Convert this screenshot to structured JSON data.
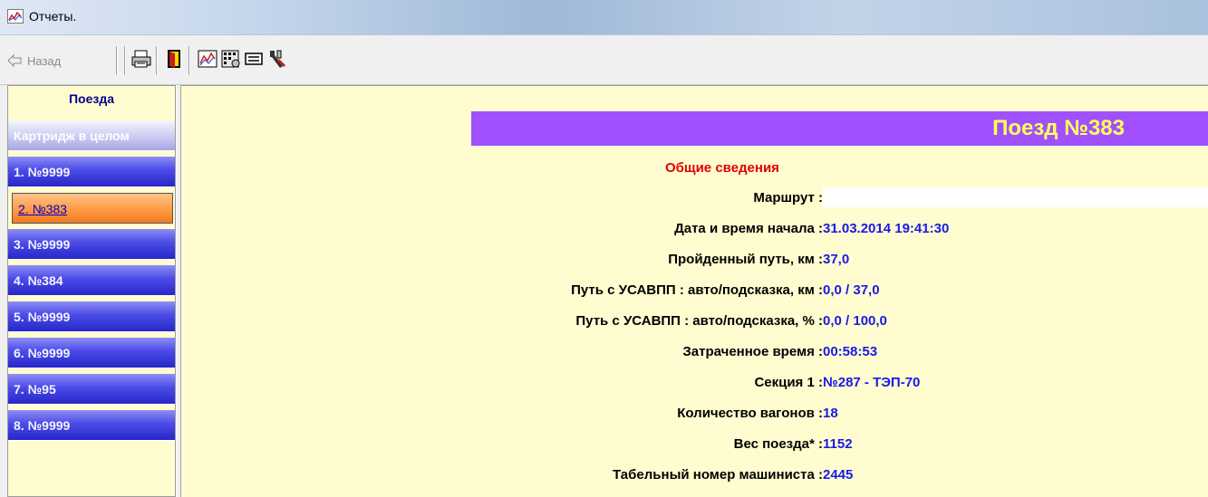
{
  "window": {
    "title": "Отчеты.",
    "icon": "chart-icon"
  },
  "toolbar": {
    "back_label": "Назад",
    "buttons": [
      "print-icon",
      "exit-door-icon",
      "chart-icon",
      "settings-chart-icon",
      "display-icon",
      "tools-icon"
    ]
  },
  "sidebar": {
    "header": "Поезда",
    "items": [
      {
        "label": "Картридж в целом",
        "state": "gray"
      },
      {
        "label": "1. №9999",
        "state": "normal"
      },
      {
        "label": "2. №383",
        "state": "active"
      },
      {
        "label": "3. №9999",
        "state": "normal"
      },
      {
        "label": "4. №384",
        "state": "normal"
      },
      {
        "label": "5. №9999",
        "state": "normal"
      },
      {
        "label": "6. №9999",
        "state": "normal"
      },
      {
        "label": "7. №95",
        "state": "normal"
      },
      {
        "label": "8. №9999",
        "state": "normal"
      }
    ]
  },
  "report": {
    "title": "Поезд №383",
    "section_title": "Общие сведения",
    "rows": [
      {
        "label": "Маршрут :",
        "value": ""
      },
      {
        "label": "Дата и время начала :",
        "value": "31.03.2014 19:41:30"
      },
      {
        "label": "Пройденный путь, км :",
        "value": "37,0"
      },
      {
        "label": "Путь с УСАВПП : авто/подсказка, км :",
        "value": "0,0 / 37,0"
      },
      {
        "label": "Путь с УСАВПП : авто/подсказка, % :",
        "value": "0,0 / 100,0"
      },
      {
        "label": "Затраченное время :",
        "value": "00:58:53"
      },
      {
        "label": "Секция 1 :",
        "value": "№287 - ТЭП-70"
      },
      {
        "label": "Количество вагонов :",
        "value": "18"
      },
      {
        "label": "Вес поезда* :",
        "value": "1152"
      },
      {
        "label": "Табельный номер машиниста :",
        "value": "2445"
      }
    ]
  },
  "colors": {
    "panel_bg": "#fffcd0",
    "banner": "#a050ff",
    "banner_text": "#ffff5a",
    "section_title": "#e00000",
    "value_text": "#1a1ae6"
  }
}
